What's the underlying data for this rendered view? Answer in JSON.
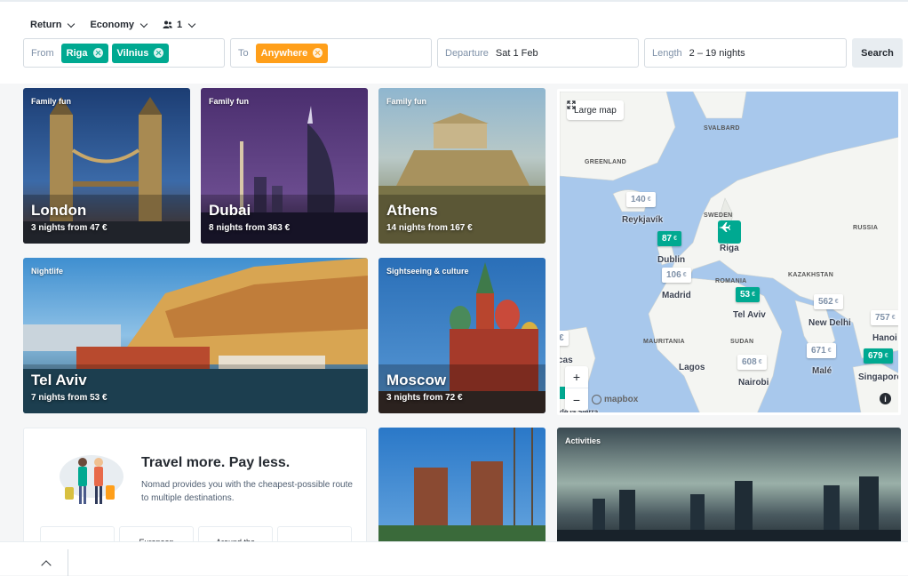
{
  "search": {
    "options": [
      {
        "label": "Return"
      },
      {
        "label": "Economy"
      },
      {
        "label": "1"
      }
    ],
    "from_label": "From",
    "from_chips": [
      "Riga",
      "Vilnius"
    ],
    "to_label": "To",
    "to_chips": [
      "Anywhere"
    ],
    "departure_label": "Departure",
    "departure_value": "Sat 1 Feb",
    "length_label": "Length",
    "length_value": "2 – 19 nights",
    "search_button": "Search"
  },
  "cards": [
    {
      "tag": "Family fun",
      "city": "London",
      "info": "3 nights from 47 €"
    },
    {
      "tag": "Family fun",
      "city": "Dubai",
      "info": "8 nights from 363 €"
    },
    {
      "tag": "Family fun",
      "city": "Athens",
      "info": "14 nights from 167 €"
    },
    {
      "tag": "Nightlife",
      "city": "Tel Aviv",
      "info": "7 nights from 53 €"
    },
    {
      "tag": "Sightseeing & culture",
      "city": "Moscow",
      "info": "3 nights from 72 €"
    },
    {
      "tag": "",
      "city": "",
      "info": ""
    },
    {
      "tag": "Activities",
      "city": "",
      "info": ""
    }
  ],
  "map": {
    "large_map_label": "Large map",
    "countries": [
      "SVALBARD",
      "GREENLAND",
      "SWEDEN",
      "RUSSIA",
      "KAZAKHSTAN",
      "ROMANIA",
      "MAURITANIA",
      "SUDAN"
    ],
    "prices": [
      {
        "value": "140",
        "currency": "€",
        "city": "Reykjavík",
        "highlight": false
      },
      {
        "value": "87",
        "currency": "€",
        "city": "Dublin",
        "highlight": true
      },
      {
        "value": "106",
        "currency": "€",
        "city": "Madrid",
        "highlight": false
      },
      {
        "value": "53",
        "currency": "€",
        "city": "Tel Aviv",
        "highlight": true
      },
      {
        "value": "562",
        "currency": "€",
        "city": "New Delhi",
        "highlight": false
      },
      {
        "value": "757",
        "currency": "€",
        "city": "Hanoi",
        "highlight": false
      },
      {
        "value": "671",
        "currency": "€",
        "city": "Malé",
        "highlight": false
      },
      {
        "value": "608",
        "currency": "€",
        "city": "Nairobi",
        "highlight": false
      },
      {
        "value": "679",
        "currency": "€",
        "city": "Singapore",
        "highlight": true
      }
    ],
    "other_cities": [
      "Riga",
      "Lagos"
    ],
    "edge_fragments": [
      "cas",
      "de la Sierra"
    ],
    "zoom_in": "+",
    "zoom_out": "−",
    "attribution": "mapbox",
    "info": "i",
    "colors": {
      "water": "#a8c8ec",
      "land": "#f4f5f2",
      "accent": "#00a991"
    }
  },
  "promo": {
    "title": "Travel more. Pay less.",
    "text": "Nomad provides you with the cheapest-possible route to multiple destinations.",
    "pills": [
      "",
      "European",
      "Around the",
      ""
    ]
  },
  "colors": {
    "teal": "#00a991",
    "orange": "#ff9f1a"
  }
}
